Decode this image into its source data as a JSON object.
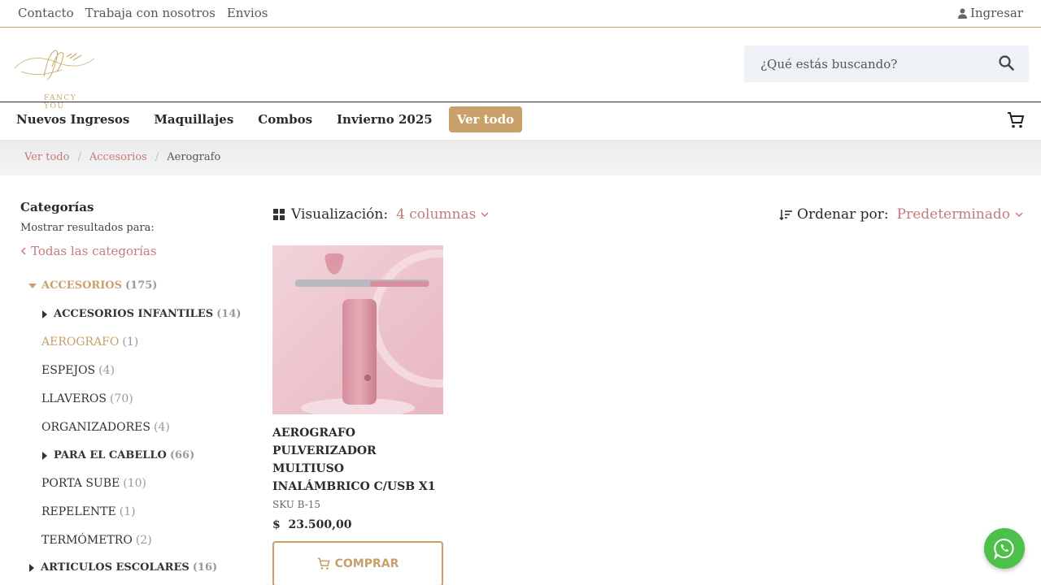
{
  "topbar": {
    "links": [
      "Contacto",
      "Trabaja con nosotros",
      "Envios"
    ],
    "login": "Ingresar"
  },
  "logo": {
    "text": "FANCY YOU"
  },
  "search": {
    "placeholder": "¿Qué estás buscando?"
  },
  "nav": {
    "items": [
      "Nuevos Ingresos",
      "Maquillajes",
      "Combos",
      "Invierno 2025"
    ],
    "active": "Ver todo"
  },
  "breadcrumb": [
    "Ver todo",
    "Accesorios",
    "Aerografo"
  ],
  "sidebar": {
    "title": "Categorías",
    "subtitle": "Mostrar resultados para:",
    "all": "Todas las categorías",
    "categories": [
      {
        "label": "ACCESORIOS",
        "count": "(175)"
      },
      {
        "label": "ACCESORIOS INFANTILES",
        "count": "(14)"
      },
      {
        "label": "AEROGRAFO",
        "count": "(1)"
      },
      {
        "label": "ESPEJOS",
        "count": "(4)"
      },
      {
        "label": "LLAVEROS",
        "count": "(70)"
      },
      {
        "label": "ORGANIZADORES",
        "count": "(4)"
      },
      {
        "label": "PARA EL CABELLO",
        "count": "(66)"
      },
      {
        "label": "PORTA SUBE",
        "count": "(10)"
      },
      {
        "label": "REPELENTE",
        "count": "(1)"
      },
      {
        "label": "TERMÓMETRO",
        "count": "(2)"
      },
      {
        "label": "ARTICULOS ESCOLARES",
        "count": "(16)"
      }
    ]
  },
  "controls": {
    "viz_label": "Visualización:",
    "viz_value": "4 columnas",
    "sort_label": "Ordenar por:",
    "sort_value": "Predeterminado"
  },
  "product": {
    "name": "AEROGRAFO PULVERIZADOR MULTIUSO INALÁMBRICO C/USB X1",
    "sku": "SKU B-15",
    "currency": "$",
    "price": "23.500,00",
    "buy": "COMPRAR"
  },
  "colors": {
    "accent": "#c9a06a",
    "link": "#c47b7b",
    "whatsapp": "#4cc04a"
  }
}
